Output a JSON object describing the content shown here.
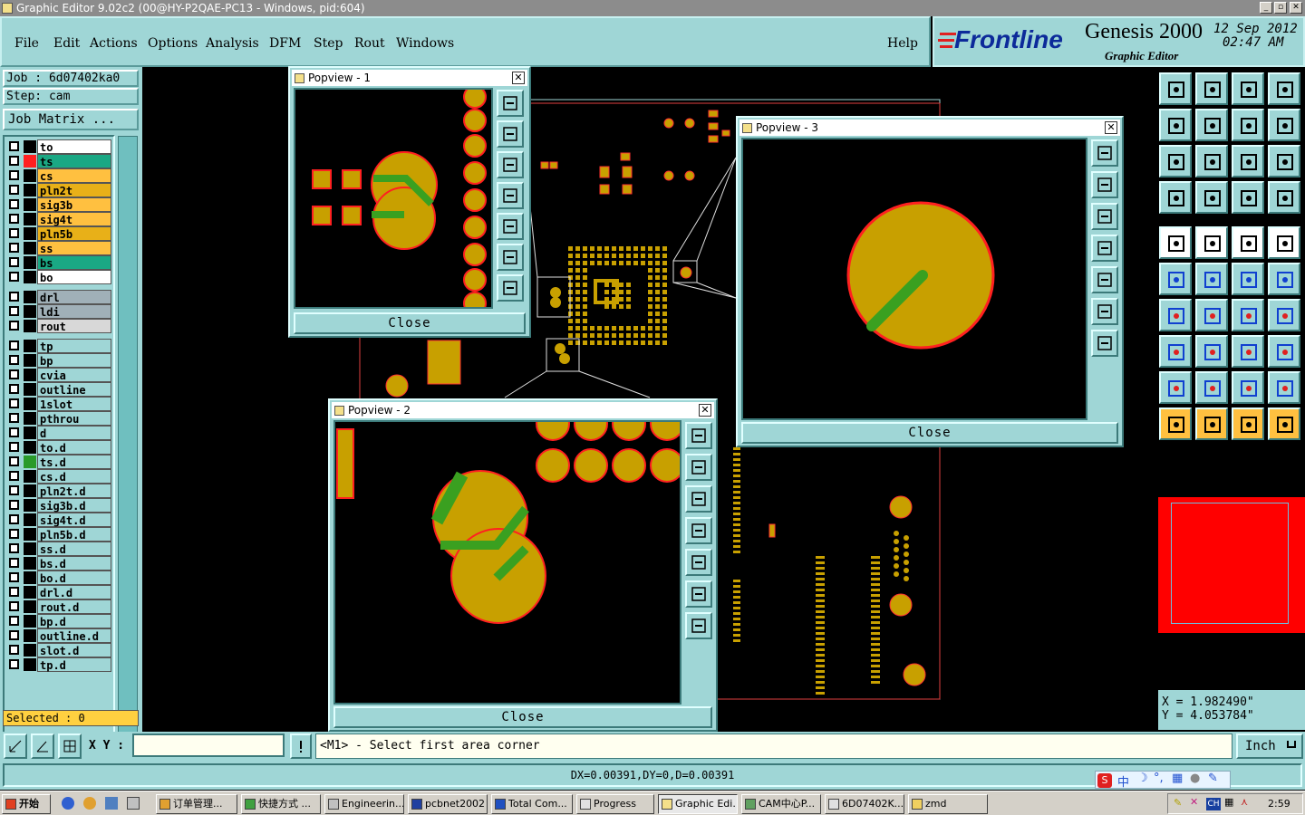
{
  "window": {
    "title": "Graphic Editor 9.02c2 (00@HY-P2QAE-PC13 - Windows, pid:604)"
  },
  "menu": [
    "File",
    "Edit",
    "Actions",
    "Options",
    "Analysis",
    "DFM",
    "Step",
    "Rout",
    "Windows"
  ],
  "help_label": "Help",
  "brand": {
    "logo": "Frontline",
    "product": "Genesis 2000",
    "subtitle": "Graphic Editor",
    "date": "12 Sep 2012",
    "time": "02:47 AM"
  },
  "job": {
    "job_label": "Job : 6d07402ka0",
    "step_label": "Step: cam",
    "matrix_button": "Job Matrix ..."
  },
  "layers_board": [
    {
      "name": "to",
      "color": "#ffffff",
      "cbox": "#000000"
    },
    {
      "name": "ts",
      "color": "#1aa884",
      "cbox": "#ff2020"
    },
    {
      "name": "cs",
      "color": "#ffc040",
      "cbox": "#000000"
    },
    {
      "name": "pln2t",
      "color": "#e8b018",
      "cbox": "#000000"
    },
    {
      "name": "sig3b",
      "color": "#ffc040",
      "cbox": "#000000"
    },
    {
      "name": "sig4t",
      "color": "#ffc040",
      "cbox": "#000000"
    },
    {
      "name": "pln5b",
      "color": "#e8b018",
      "cbox": "#000000"
    },
    {
      "name": "ss",
      "color": "#ffc040",
      "cbox": "#000000"
    },
    {
      "name": "bs",
      "color": "#1aa884",
      "cbox": "#000000"
    },
    {
      "name": "bo",
      "color": "#ffffff",
      "cbox": "#000000"
    }
  ],
  "layers_drill": [
    {
      "name": "drl",
      "color": "#a0b0b8",
      "cbox": "#000000"
    },
    {
      "name": "ldi",
      "color": "#a0b0b8",
      "cbox": "#000000"
    },
    {
      "name": "rout",
      "color": "#d8d8d8",
      "cbox": "#000000"
    }
  ],
  "layers_misc": [
    {
      "name": "tp",
      "color": "#9fd6d6",
      "cbox": "#000000"
    },
    {
      "name": "bp",
      "color": "#9fd6d6",
      "cbox": "#000000"
    },
    {
      "name": "cvia",
      "color": "#9fd6d6",
      "cbox": "#000000"
    },
    {
      "name": "outline",
      "color": "#9fd6d6",
      "cbox": "#000000"
    },
    {
      "name": "1slot",
      "color": "#9fd6d6",
      "cbox": "#000000"
    },
    {
      "name": "pthrou",
      "color": "#9fd6d6",
      "cbox": "#000000"
    },
    {
      "name": "d",
      "color": "#9fd6d6",
      "cbox": "#000000"
    },
    {
      "name": "to.d",
      "color": "#9fd6d6",
      "cbox": "#000000"
    },
    {
      "name": "ts.d",
      "color": "#9fd6d6",
      "cbox": "#2a9a2a"
    },
    {
      "name": "cs.d",
      "color": "#9fd6d6",
      "cbox": "#000000"
    },
    {
      "name": "pln2t.d",
      "color": "#9fd6d6",
      "cbox": "#000000"
    },
    {
      "name": "sig3b.d",
      "color": "#9fd6d6",
      "cbox": "#000000"
    },
    {
      "name": "sig4t.d",
      "color": "#9fd6d6",
      "cbox": "#000000"
    },
    {
      "name": "pln5b.d",
      "color": "#9fd6d6",
      "cbox": "#000000"
    },
    {
      "name": "ss.d",
      "color": "#9fd6d6",
      "cbox": "#000000"
    },
    {
      "name": "bs.d",
      "color": "#9fd6d6",
      "cbox": "#000000"
    },
    {
      "name": "bo.d",
      "color": "#9fd6d6",
      "cbox": "#000000"
    },
    {
      "name": "drl.d",
      "color": "#9fd6d6",
      "cbox": "#000000"
    },
    {
      "name": "rout.d",
      "color": "#9fd6d6",
      "cbox": "#000000"
    },
    {
      "name": "bp.d",
      "color": "#9fd6d6",
      "cbox": "#000000"
    },
    {
      "name": "outline.d",
      "color": "#9fd6d6",
      "cbox": "#000000"
    },
    {
      "name": "slot.d",
      "color": "#9fd6d6",
      "cbox": "#000000"
    },
    {
      "name": "tp.d",
      "color": "#9fd6d6",
      "cbox": "#000000"
    }
  ],
  "selected_label": "Selected : 0",
  "popviews": [
    {
      "title": "Popview - 1",
      "close": "Close"
    },
    {
      "title": "Popview - 2",
      "close": "Close"
    },
    {
      "title": "Popview - 3",
      "close": "Close"
    }
  ],
  "coords": {
    "x": "X = 1.982490\"",
    "y": "Y = 4.053784\""
  },
  "cmd": {
    "xy_label": "X Y :",
    "xy_value": "",
    "prompt": "<M1> - Select first area corner",
    "units": "Inch"
  },
  "status": {
    "delta": "DX=0.00391,DY=0,D=0.00391"
  },
  "taskbar": {
    "start": "开始",
    "tasks": [
      "订单管理...",
      "快捷方式 ...",
      "Engineerin...",
      "pcbnet2002",
      "Total Com...",
      "Progress",
      "Graphic Edi...",
      "CAM中心P...",
      "6D07402K...",
      "zmd"
    ],
    "clock": "2:59",
    "ime": "中"
  },
  "colors": {
    "panel": "#9fd6d6",
    "pad": "#c8a000",
    "pad_outline": "#ff2020",
    "trace": "#3aa020"
  }
}
